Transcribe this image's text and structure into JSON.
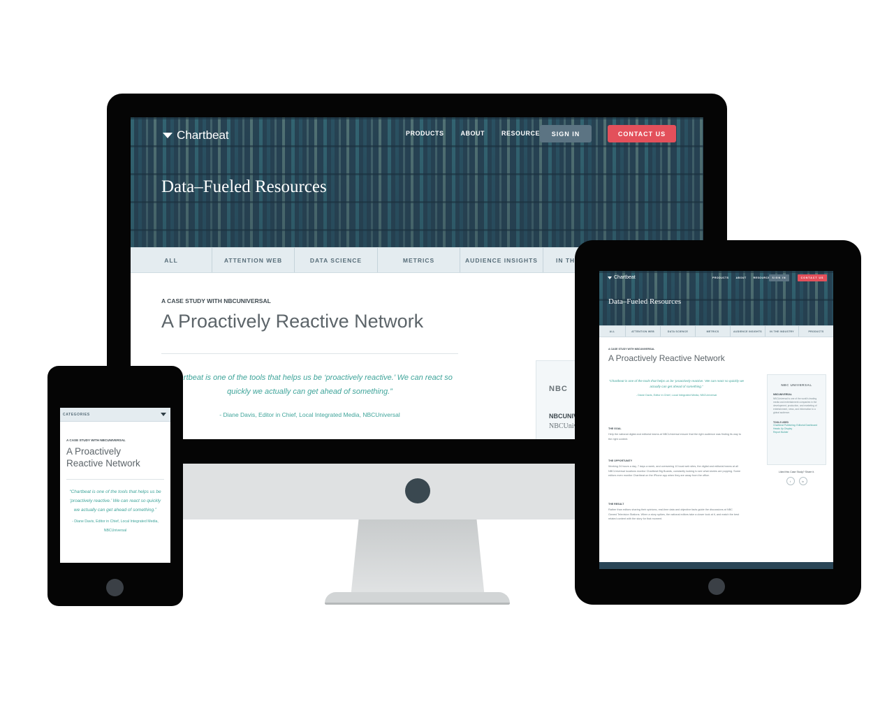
{
  "brand": {
    "name": "Chartbeat"
  },
  "nav": {
    "products": "PRODUCTS",
    "about": "ABOUT",
    "resources": "RESOURCES",
    "sign_in": "SIGN IN",
    "contact": "CONTACT US"
  },
  "hero": {
    "title": "Data–Fueled Resources"
  },
  "tabs": [
    "ALL",
    "ATTENTION WEB",
    "DATA SCIENCE",
    "METRICS",
    "AUDIENCE INSIGHTS",
    "IN THE INDUSTRY",
    "PRODUCTS"
  ],
  "imac_tab_partial": "IN THE",
  "case_study": {
    "eyebrow": "A CASE STUDY WITH NBCUNIVERSAL",
    "title": "A Proactively Reactive Network",
    "title_line1": "A Proactively",
    "title_line2": "Reactive Network",
    "quote": "“Chartbeat is one of the tools that helps us be ‘proactively reactive.’ We can react so quickly we actually can get ahead of something.”",
    "attribution": "- Diane Davis, Editor in Chief, Local Integrated Media, NBCUniversal"
  },
  "sidebar": {
    "logo_text": "NBC UNIVERSAL",
    "imac_logo_partial": "NBC",
    "company": "NBCUNIVERSAL",
    "imac_company_partial": "NBCUNIV",
    "imac_desc_partial": "NBCUniv",
    "description": "NBCUniversal is one of the world's leading media and entertainment companies in the development, production, and marketing of entertainment, news, and information to a global audience.",
    "tools_label": "TOOLS USED",
    "tools": [
      "Chartbeat Publishing: Editorial Dashboard",
      "Heads Up Display",
      "Report Builder"
    ],
    "share_label": "Liked this Case Study? Share it.",
    "share_icons": [
      "twitter-icon",
      "linkedin-icon"
    ]
  },
  "sections": {
    "goal_label": "THE GOAL",
    "goal_text": "Help the national digital and editorial teams at NBCUniversal ensure that the right audience was finding its way to the right content.",
    "opportunity_label": "THE OPPORTUNITY",
    "opportunity_text": "Working 24 hours a day, 7 days a week, and overseeing 10 local web sites, the digital and editorial teams at all NBCUniversal locations monitor Chartbeat Big Boards, constantly looking to see what stories are popping. Some editors even monitor Chartbeat on the iPhone app when they are away from the office.",
    "result_label": "THE RESULT",
    "result_text": "Rather than editors sharing their opinions, real-time data and objective facts guide the discussions at NBC Owned Television Stations. When a story spikes, the national editors take a closer look at it, and match the best related content with the story for that moment."
  },
  "phone": {
    "categories_label": "CATEGORIES"
  },
  "colors": {
    "hero": "#2a4657",
    "accent_red": "#e3505b",
    "teal_text": "#3fa49a",
    "tab_bg": "#e4ecf0",
    "sign_in_btn": "#5c7483"
  }
}
